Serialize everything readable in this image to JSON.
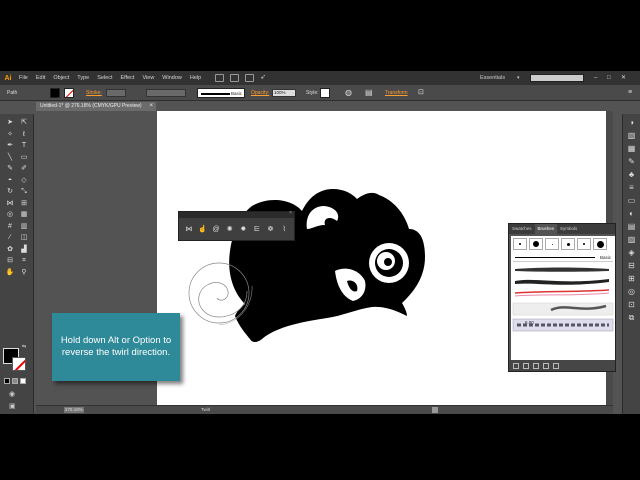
{
  "app": {
    "logo": "Ai",
    "menus": [
      "File",
      "Edit",
      "Object",
      "Type",
      "Select",
      "Effect",
      "View",
      "Window",
      "Help"
    ],
    "workspace": "Essentials",
    "window_controls": [
      "–",
      "□",
      "✕"
    ]
  },
  "control": {
    "selection_label": "Path",
    "stroke_label": "Stroke:",
    "brush_name": "Basic",
    "opacity_label": "Opacity:",
    "opacity_value": "100%",
    "style_label": "Style:",
    "transform_label": "Transform"
  },
  "document": {
    "tab_title": "Untitled-1* @ 276.18% (CMYK/GPU Preview)",
    "close": "×"
  },
  "status": {
    "zoom": "276.18%",
    "tool": "Twirl"
  },
  "brushes_panel": {
    "tabs": [
      "Swatches",
      "Brushes",
      "Symbols"
    ],
    "basic_label": "Basic",
    "size_value": "6.00"
  },
  "callout": {
    "text": "Hold down Alt or Option to reverse the twirl direction."
  },
  "colors": {
    "callout_bg": "#2e8a98",
    "accent_orange": "#ff9a00",
    "artboard": "#ffffff",
    "ui_dark": "#535353"
  },
  "icons": {
    "tools": [
      "selection-icon",
      "direct-selection-icon",
      "magic-wand-icon",
      "lasso-icon",
      "pen-icon",
      "type-icon",
      "line-icon",
      "rectangle-icon",
      "paintbrush-icon",
      "pencil-icon",
      "blob-brush-icon",
      "eraser-icon",
      "rotate-icon",
      "scale-icon",
      "width-icon",
      "free-transform-icon",
      "shape-builder-icon",
      "perspective-icon",
      "mesh-icon",
      "gradient-icon",
      "eyedropper-icon",
      "blend-icon",
      "symbol-sprayer-icon",
      "graph-icon",
      "artboard-icon",
      "slice-icon",
      "hand-icon",
      "zoom-icon"
    ],
    "warp_tools": [
      "width-tool-icon",
      "warp-tool-icon",
      "twirl-tool-icon",
      "pucker-tool-icon",
      "bloat-tool-icon",
      "scallop-tool-icon",
      "crystallize-tool-icon",
      "wrinkle-tool-icon"
    ]
  }
}
